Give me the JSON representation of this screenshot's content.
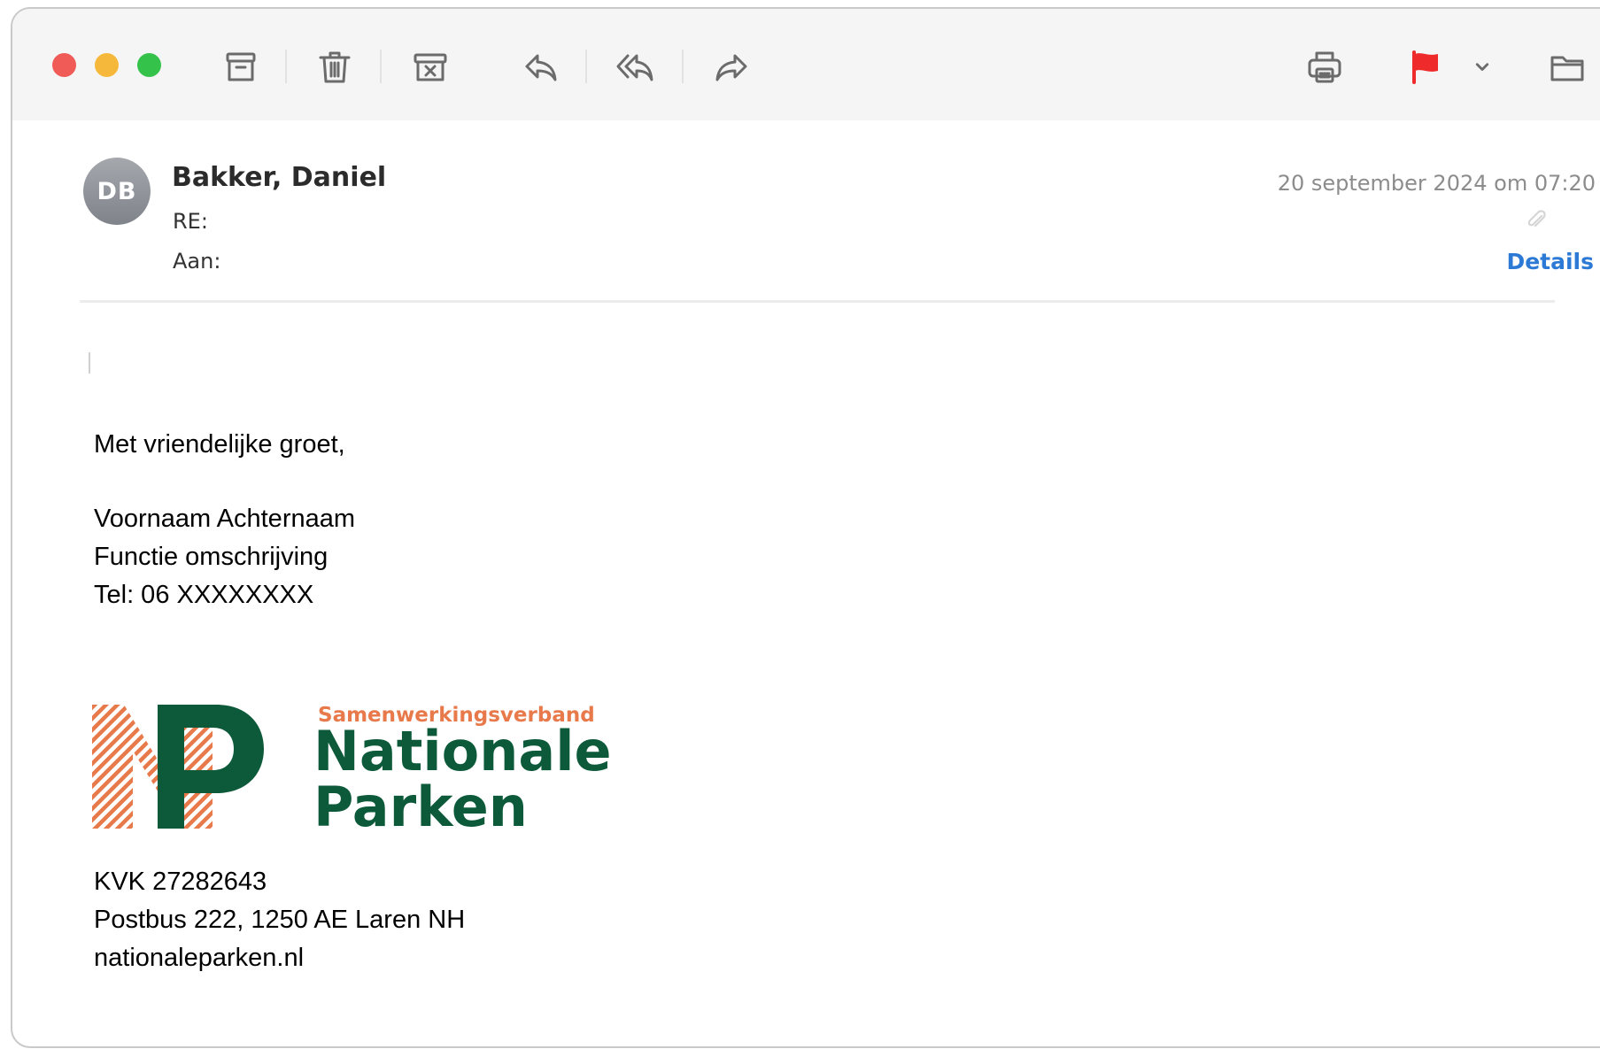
{
  "window": {
    "traffic_lights": {
      "close_color": "#f05a57",
      "minimize_color": "#f6b83a",
      "zoom_color": "#35c24b"
    }
  },
  "toolbar": {
    "icons": [
      "archive-icon",
      "trash-icon",
      "junk-icon",
      "reply-icon",
      "reply-all-icon",
      "forward-icon",
      "print-icon",
      "flag-icon",
      "chevron-down-icon",
      "move-to-folder-icon"
    ],
    "flag_color": "#ef2a2a"
  },
  "message": {
    "avatar_initials": "DB",
    "sender": "Bakker, Daniel",
    "subject_label": "RE:",
    "to_label": "Aan:",
    "date": "20 september 2024 om 07:20",
    "details_link": "Details",
    "accent_color": "#2d7ad6"
  },
  "body": {
    "greeting": "Met vriendelijke groet,",
    "name": "Voornaam Achternaam",
    "role": "Functie omschrijving",
    "phone": "Tel: 06 XXXXXXXX"
  },
  "signature": {
    "logo_subtitle": "Samenwerkingsverband",
    "logo_title_line1": "Nationale",
    "logo_title_line2": "Parken",
    "logo_green": "#0d5a3b",
    "logo_orange": "#e8794a",
    "kvk": "KVK 27282643",
    "address": "Postbus 222, 1250 AE Laren NH",
    "website": "nationaleparken.nl"
  }
}
